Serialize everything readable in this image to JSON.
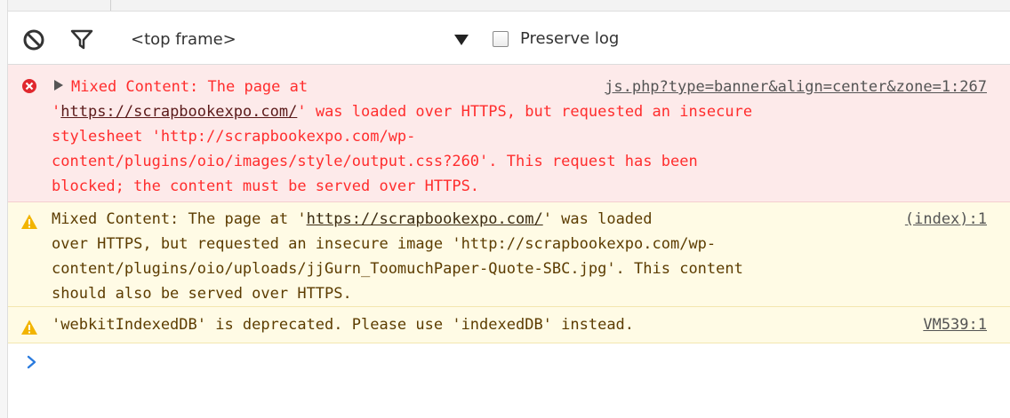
{
  "toolbar": {
    "clear_icon": "block-icon",
    "filter_icon": "filter-icon",
    "frame_select_label": "<top frame>",
    "preserve_log_label": "Preserve log",
    "preserve_log_checked": false
  },
  "messages": [
    {
      "level": "error",
      "icon": "error-circle-icon",
      "source": "js.php?type=banner&align=center&zone=1:267",
      "lines": [
        [
          "Mixed Content: The page at"
        ],
        [
          "'",
          "https://scrapbookexpo.com/",
          "' was loaded over HTTPS, but requested an insecure"
        ],
        [
          "stylesheet 'http://scrapbookexpo.com/wp-"
        ],
        [
          "content/plugins/oio/images/style/output.css?260'. This request has been"
        ],
        [
          "blocked; the content must be served over HTTPS."
        ]
      ]
    },
    {
      "level": "warning",
      "icon": "warning-triangle-icon",
      "source": "(index):1",
      "lines": [
        [
          "Mixed Content: The page at '",
          "https://scrapbookexpo.com/",
          "' was loaded"
        ],
        [
          "over HTTPS, but requested an insecure image 'http://scrapbookexpo.com/wp-"
        ],
        [
          "content/plugins/oio/uploads/jjGurn_ToomuchPaper-Quote-SBC.jpg'. This content"
        ],
        [
          "should also be served over HTTPS."
        ]
      ]
    },
    {
      "level": "warning",
      "icon": "warning-triangle-icon",
      "source": "VM539:1",
      "lines": [
        [
          "'webkitIndexedDB' is deprecated. Please use 'indexedDB' instead."
        ]
      ]
    }
  ],
  "prompt": {
    "icon": "prompt-chevron-icon"
  },
  "colors": {
    "error_text": "#ff2d2d",
    "error_bg": "#fdeaea",
    "warning_text": "#5c3c00",
    "warning_bg": "#fffbe5",
    "warning_icon": "#f2b400",
    "error_icon": "#e0282e",
    "prompt_chevron": "#2a7bde"
  }
}
